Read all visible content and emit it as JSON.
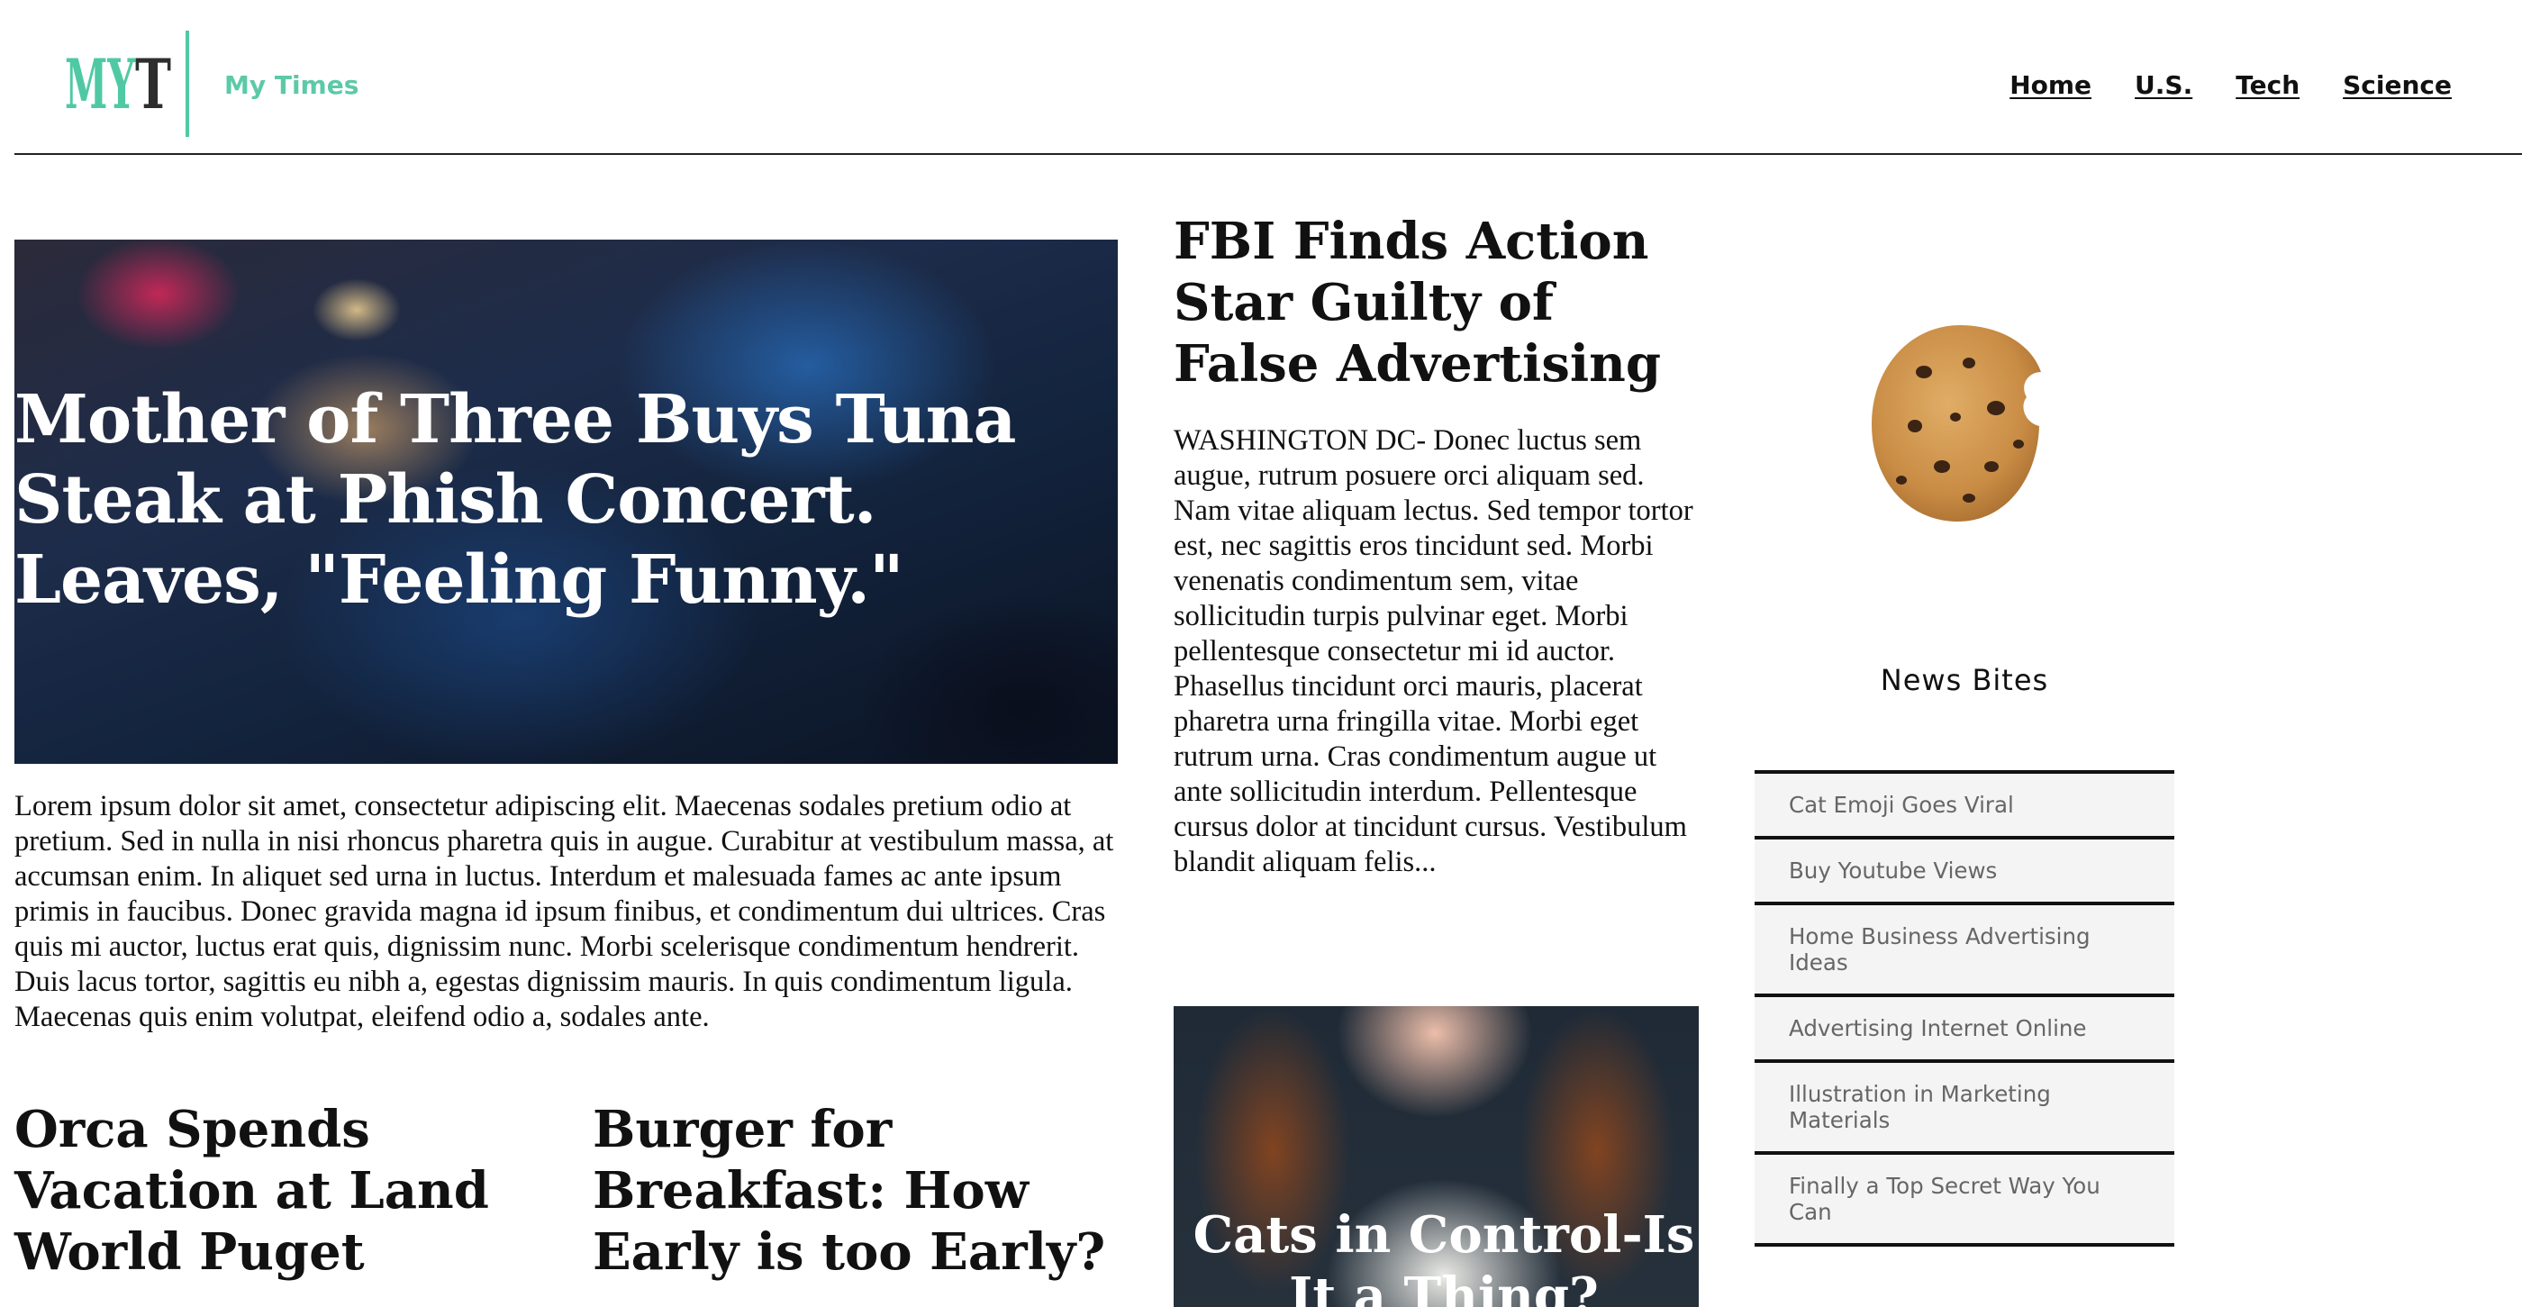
{
  "header": {
    "logo_text": "MYT",
    "brand_name": "My Times",
    "nav": [
      {
        "label": "Home"
      },
      {
        "label": "U.S."
      },
      {
        "label": "Tech"
      },
      {
        "label": "Science"
      }
    ],
    "brand_color": "#5cc9a7"
  },
  "hero": {
    "title": "Mother of Three Buys Tuna Steak at Phish Concert. Leaves, \"Feeling Funny.\"",
    "body": "Lorem ipsum dolor sit amet, consectetur adipiscing elit. Maecenas sodales pretium odio at pretium. Sed in nulla in nisi rhoncus pharetra quis in augue. Curabitur at vestibulum massa, at accumsan enim. In aliquet sed urna in luctus. Interdum et malesuada fames ac ante ipsum primis in faucibus. Donec gravida magna id ipsum finibus, et condimentum dui ultrices. Cras quis mi auctor, luctus erat quis, dignissim nunc. Morbi scelerisque condimentum hendrerit. Duis lacus tortor, sagittis eu nibh a, egestas dignissim mauris. In quis condimentum ligula. Maecenas quis enim volutpat, eleifend odio a, sodales ante."
  },
  "secondary": {
    "orca_title": "Orca Spends Vacation at Land World Puget",
    "burger_title": "Burger for Breakfast: How Early is too Early?"
  },
  "feature": {
    "title": "FBI Finds Action Star Guilty of False Advertising",
    "body": "WASHINGTON DC- Donec luctus sem augue, rutrum posuere orci aliquam sed. Nam vitae aliquam lectus. Sed tempor tortor est, nec sagittis eros tincidunt sed. Morbi venenatis condimentum sem, vitae sollicitudin turpis pulvinar eget. Morbi pellentesque consectetur mi id auctor. Phasellus tincidunt orci mauris, placerat pharetra urna fringilla vitae. Morbi eget rutrum urna. Cras condimentum augue ut ante sollicitudin interdum. Pellentesque cursus dolor at tincidunt cursus. Vestibulum blandit aliquam felis..."
  },
  "cats": {
    "title": "Cats in Control-Is It a Thing?"
  },
  "sidebar": {
    "title": "News Bites",
    "items": [
      {
        "label": "Cat Emoji Goes Viral"
      },
      {
        "label": "Buy Youtube Views"
      },
      {
        "label": "Home Business Advertising Ideas"
      },
      {
        "label": "Advertising Internet Online"
      },
      {
        "label": "Illustration in Marketing Materials"
      },
      {
        "label": "Finally a Top Secret Way You Can"
      }
    ]
  }
}
